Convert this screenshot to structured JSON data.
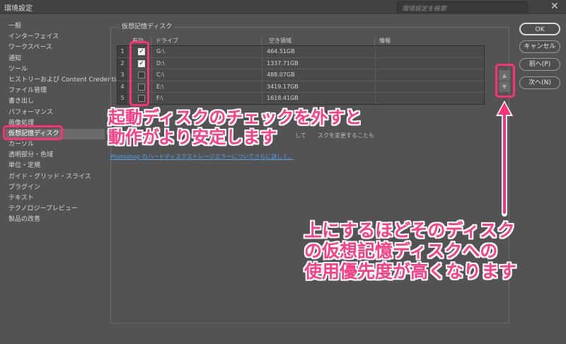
{
  "window": {
    "title": "環境設定",
    "search_placeholder": "環境設定を検索",
    "close_glyph": "✕"
  },
  "sidebar": {
    "items": [
      {
        "label": "一般"
      },
      {
        "label": "インターフェイス"
      },
      {
        "label": "ワークスペース"
      },
      {
        "label": "通知"
      },
      {
        "label": "ツール"
      },
      {
        "label": "ヒストリーおよび Content Credentials"
      },
      {
        "label": "ファイル管理"
      },
      {
        "label": "書き出し"
      },
      {
        "label": "パフォーマンス"
      },
      {
        "label": "画像処理"
      },
      {
        "label": "仮想記憶ディスク",
        "selected": true
      },
      {
        "label": "カーソル"
      },
      {
        "label": "透明部分・色域"
      },
      {
        "label": "単位・定規"
      },
      {
        "label": "ガイド・グリッド・スライス"
      },
      {
        "label": "プラグイン"
      },
      {
        "label": "テキスト"
      },
      {
        "label": "テクノロジープレビュー"
      },
      {
        "label": "製品の改善"
      }
    ]
  },
  "panel": {
    "legend": "仮想記憶ディスク",
    "columns": {
      "active": "有効",
      "drive": "ドライブ",
      "free_space": "空き領域",
      "info": "情報"
    },
    "rows": [
      {
        "num": "1",
        "checked": true,
        "drive": "G:\\",
        "free_space": "464.51GB"
      },
      {
        "num": "2",
        "checked": true,
        "drive": "D:\\",
        "free_space": "1337.71GB"
      },
      {
        "num": "3",
        "checked": false,
        "drive": "C:\\",
        "free_space": "488.07GB"
      },
      {
        "num": "4",
        "checked": false,
        "drive": "E:\\",
        "free_space": "3419.17GB"
      },
      {
        "num": "5",
        "checked": false,
        "drive": "F:\\",
        "free_space": "1618.41GB"
      }
    ],
    "note_fragment_1": "して",
    "note_fragment_2": "スクを変更することも",
    "link_text": "Photoshop のハードディスクストレージエラーについてさらに詳しく。"
  },
  "buttons": {
    "ok": "OK",
    "cancel": "キャンセル",
    "prev": "前へ(P)",
    "next": "次へ(N)"
  },
  "reorder": {
    "up_glyph": "▲",
    "down_glyph": "▼"
  },
  "annotations": {
    "callout1_line1": "起動ディスクのチェックを外すと",
    "callout1_line2": "動作がより安定します",
    "callout2_line1": "上にするほどそのディスク",
    "callout2_line2": "の仮想記憶ディスクへの",
    "callout2_line3": "使用優先度が高くなります",
    "color": "#ff3d86"
  }
}
